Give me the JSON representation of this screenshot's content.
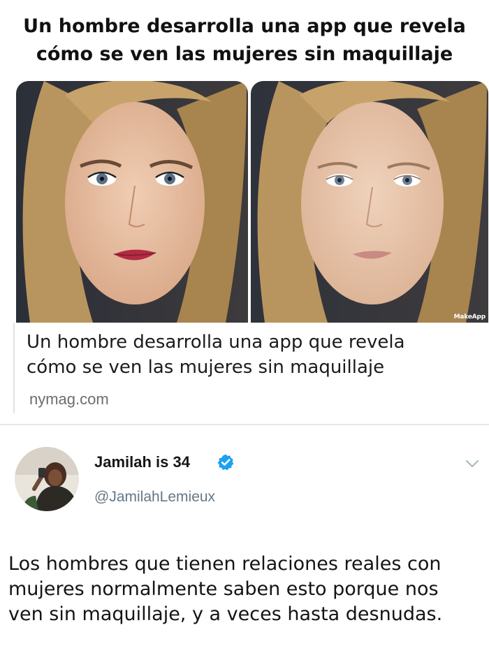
{
  "meme": {
    "title": "Un hombre desarrolla una app que revela\ncómo se ven las mujeres sin maquillaje"
  },
  "link_card": {
    "image_left": "woman-with-makeup-photo",
    "image_right": "woman-without-makeup-photo",
    "watermark": "MakeApp",
    "headline": "Un hombre desarrolla una app que revela\ncómo se ven las mujeres sin maquillaje",
    "domain": "nymag.com"
  },
  "tweet": {
    "display_name": "Jamilah is 34",
    "handle": "@JamilahLemieux",
    "verified_icon": "verified-badge-icon",
    "menu_icon": "chevron-down-icon",
    "text": "Los hombres que tienen relaciones reales con\nmujeres normalmente saben esto porque nos\nven sin maquillaje, y a veces hasta desnudas."
  },
  "colors": {
    "verified_blue": "#1da1f2",
    "handle_gray": "#657786",
    "domain_gray": "#6d6d6d",
    "divider": "#e6e6e6"
  }
}
